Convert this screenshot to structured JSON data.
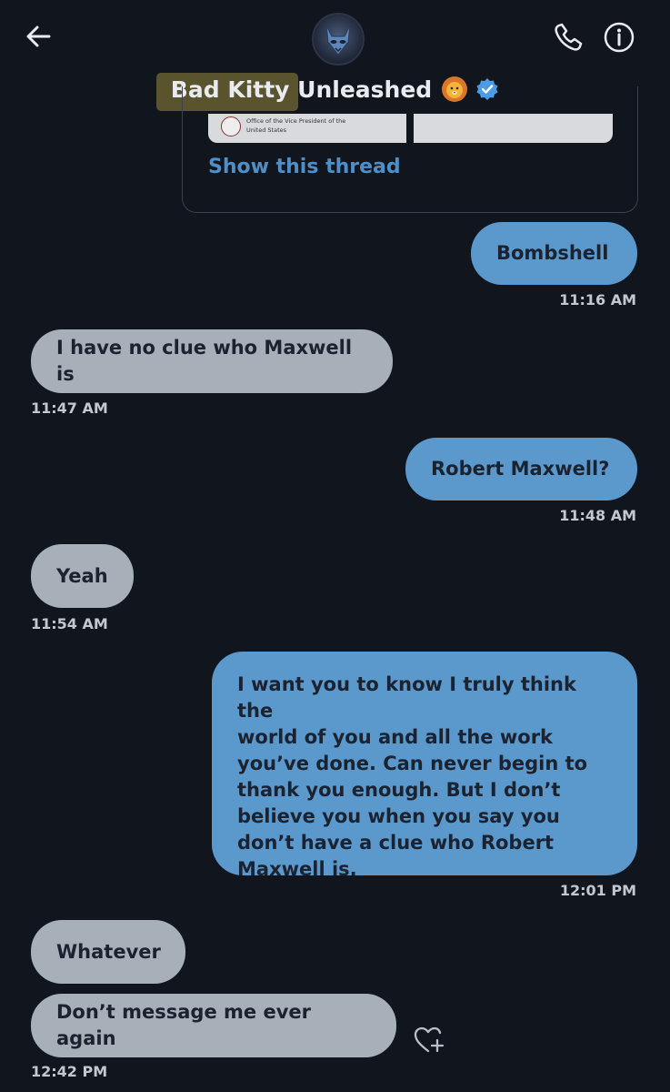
{
  "header": {
    "title_highlighted": "Bad Kitty",
    "title_rest": " Unleashed",
    "avatar_icon": "cat-mask-avatar-icon",
    "back_icon": "back-arrow-icon",
    "call_icon": "phone-icon",
    "info_icon": "info-icon",
    "emoji_icon": "lion-face-emoji-icon",
    "verified_icon": "verified-badge-icon"
  },
  "thread_card": {
    "image_caption_line1": "Office of the Vice President of the",
    "image_caption_line2": "United States",
    "show_thread": "Show this thread"
  },
  "messages": [
    {
      "direction": "sent",
      "text": "Bombshell",
      "time": "11:16 AM"
    },
    {
      "direction": "received",
      "text": "I have no clue who Maxwell is",
      "time": "11:47 AM"
    },
    {
      "direction": "sent",
      "text": "Robert Maxwell?",
      "time": "11:48 AM"
    },
    {
      "direction": "received",
      "text": "Yeah",
      "time": "11:54 AM"
    },
    {
      "direction": "sent",
      "lines": [
        "I want you to know I truly think the",
        "world of you and all the work",
        "you’ve done. Can never begin to",
        "thank you enough. But I don’t",
        "believe you when you say you",
        "don’t have a clue who Robert",
        "Maxwell is."
      ],
      "time": "12:01 PM"
    },
    {
      "direction": "received",
      "text": "Whatever",
      "time": ""
    },
    {
      "direction": "received",
      "text": "Don’t message me ever again",
      "time": "12:42 PM"
    }
  ],
  "reaction_icon": "add-reaction-heart-icon",
  "colors": {
    "background": "#11151d",
    "sent_bubble": "#5b98cc",
    "received_bubble": "#a7afb9",
    "link": "#4f8fc7",
    "verified": "#4a9be8"
  }
}
